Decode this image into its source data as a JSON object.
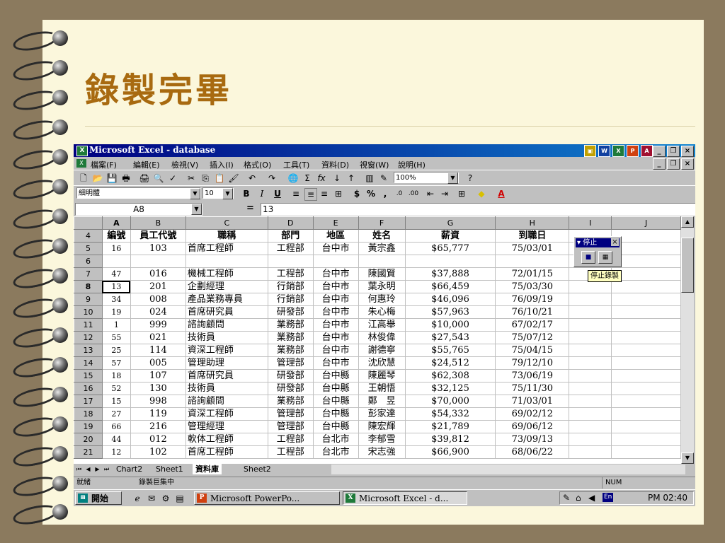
{
  "slide": {
    "title": "錄製完畢"
  },
  "window": {
    "title": "Microsoft Excel - database"
  },
  "menu": [
    "檔案(F)",
    "編輯(E)",
    "檢視(V)",
    "插入(I)",
    "格式(O)",
    "工具(T)",
    "資料(D)",
    "視窗(W)",
    "說明(H)"
  ],
  "toolbar": {
    "zoom": "100%",
    "font": "細明體",
    "size": "10",
    "bold": "B",
    "italic": "I",
    "underline": "U",
    "currency": "$",
    "percent": "%",
    "comma": ","
  },
  "formula_bar": {
    "name_box": "A8",
    "equals": "=",
    "value": "13"
  },
  "columns": [
    "A",
    "B",
    "C",
    "D",
    "E",
    "F",
    "G",
    "H",
    "I",
    "J"
  ],
  "header_row": {
    "num": "4",
    "cells": [
      "編號",
      "員工代號",
      "職稱",
      "部門",
      "地區",
      "姓名",
      "薪資",
      "到職日"
    ]
  },
  "rows": [
    {
      "num": "5",
      "cells": [
        "16",
        "103",
        "首席工程師",
        "工程部",
        "台中市",
        "黃宗鑫",
        "$65,777",
        "75/03/01"
      ]
    },
    {
      "num": "6",
      "cells": [
        "",
        "",
        "",
        "",
        "",
        "",
        "",
        ""
      ]
    },
    {
      "num": "7",
      "cells": [
        "47",
        "016",
        "機械工程師",
        "工程部",
        "台中市",
        "陳國賢",
        "$37,888",
        "72/01/15"
      ]
    },
    {
      "num": "8",
      "cells": [
        "13",
        "201",
        "企劃經理",
        "行銷部",
        "台中市",
        "葉永明",
        "$66,459",
        "75/03/30"
      ]
    },
    {
      "num": "9",
      "cells": [
        "34",
        "008",
        "產品業務專員",
        "行銷部",
        "台中市",
        "何惠玲",
        "$46,096",
        "76/09/19"
      ]
    },
    {
      "num": "10",
      "cells": [
        "19",
        "024",
        "首席研究員",
        "研發部",
        "台中市",
        "朱心梅",
        "$57,963",
        "76/10/21"
      ]
    },
    {
      "num": "11",
      "cells": [
        "1",
        "999",
        "諮詢顧問",
        "業務部",
        "台中市",
        "江高舉",
        "$10,000",
        "67/02/17"
      ]
    },
    {
      "num": "12",
      "cells": [
        "55",
        "021",
        "技術員",
        "業務部",
        "台中市",
        "林俊偉",
        "$27,543",
        "75/07/12"
      ]
    },
    {
      "num": "13",
      "cells": [
        "25",
        "114",
        "資深工程師",
        "業務部",
        "台中市",
        "謝德寧",
        "$55,765",
        "75/04/15"
      ]
    },
    {
      "num": "14",
      "cells": [
        "57",
        "005",
        "管理助理",
        "管理部",
        "台中市",
        "沈欣慧",
        "$24,512",
        "79/12/10"
      ]
    },
    {
      "num": "15",
      "cells": [
        "18",
        "107",
        "首席研究員",
        "研發部",
        "台中縣",
        "陳麗琴",
        "$62,308",
        "73/06/19"
      ]
    },
    {
      "num": "16",
      "cells": [
        "52",
        "130",
        "技術員",
        "研發部",
        "台中縣",
        "王朝悟",
        "$32,125",
        "75/11/30"
      ]
    },
    {
      "num": "17",
      "cells": [
        "15",
        "998",
        "諮詢顧問",
        "業務部",
        "台中縣",
        "鄭　昱",
        "$70,000",
        "71/03/01"
      ]
    },
    {
      "num": "18",
      "cells": [
        "27",
        "119",
        "資深工程師",
        "管理部",
        "台中縣",
        "彭家達",
        "$54,332",
        "69/02/12"
      ]
    },
    {
      "num": "19",
      "cells": [
        "66",
        "216",
        "管理經理",
        "管理部",
        "台中縣",
        "陳宏輝",
        "$21,789",
        "69/06/12"
      ]
    },
    {
      "num": "20",
      "cells": [
        "44",
        "012",
        "軟体工程師",
        "工程部",
        "台北市",
        "李郁雪",
        "$39,812",
        "73/09/13"
      ]
    },
    {
      "num": "21",
      "cells": [
        "12",
        "102",
        "首席工程師",
        "工程部",
        "台北市",
        "宋志強",
        "$66,900",
        "68/06/22"
      ]
    }
  ],
  "stop_toolbar": {
    "title": "停止",
    "close": "×",
    "stop_icon": "stop-recording-icon",
    "relative_icon": "relative-reference-icon"
  },
  "tooltip": "停止錄製",
  "sheet_tabs": [
    "Chart2",
    "Sheet1",
    "資料庫",
    "Sheet2"
  ],
  "status": {
    "ready": "就緒",
    "recording": "錄製巨集中",
    "num": "NUM"
  },
  "taskbar": {
    "start": "開始",
    "tasks": [
      "Microsoft PowerPo...",
      "Microsoft Excel - d..."
    ],
    "lang": "En",
    "clock": "PM 02:40"
  }
}
